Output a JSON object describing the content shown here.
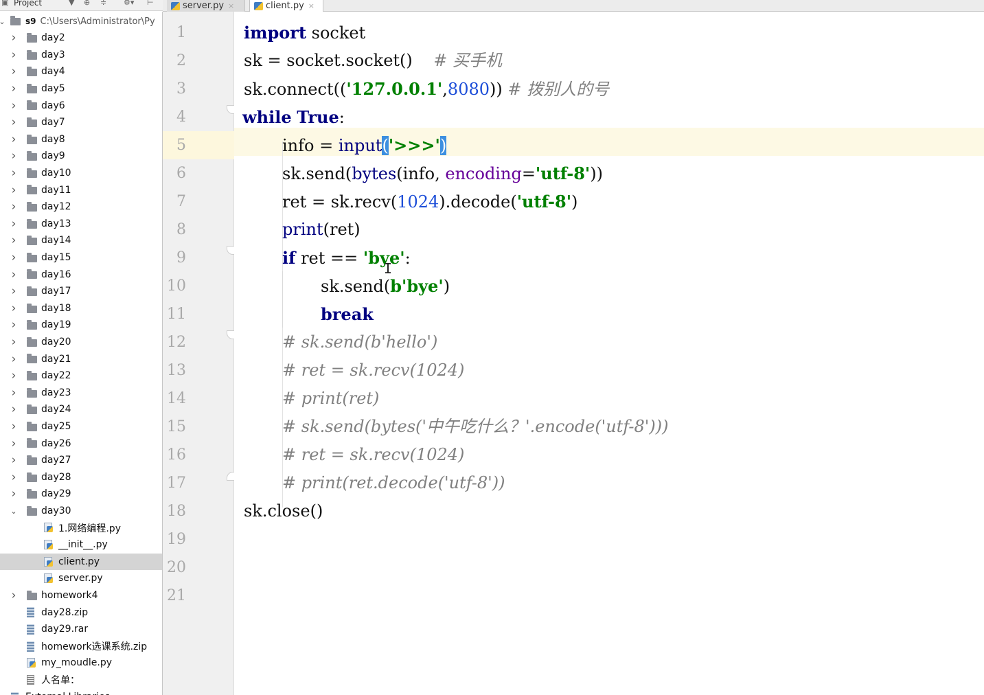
{
  "project_toolbar": {
    "title": "Project",
    "glyphs": [
      "▼",
      "⊕",
      "≑",
      "⚙▾",
      "⊢"
    ]
  },
  "tabs": [
    {
      "label": "server.py",
      "close": "×",
      "active": false
    },
    {
      "label": "client.py",
      "close": "×",
      "active": true
    }
  ],
  "tree": {
    "root": {
      "label": "s9",
      "path": "C:\\Users\\Administrator\\Py"
    },
    "days_collapsed": [
      "day2",
      "day3",
      "day4",
      "day5",
      "day6",
      "day7",
      "day8",
      "day9",
      "day10",
      "day11",
      "day12",
      "day13",
      "day14",
      "day15",
      "day16",
      "day17",
      "day18",
      "day19",
      "day20",
      "day21",
      "day22",
      "day23",
      "day24",
      "day25",
      "day26",
      "day27",
      "day28",
      "day29"
    ],
    "open_folder": "day30",
    "open_children": [
      "1.网络编程.py",
      "__init__.py",
      "client.py",
      "server.py"
    ],
    "selected_child": "client.py",
    "after": [
      {
        "label": "homework4",
        "kind": "folder"
      },
      {
        "label": "day28.zip",
        "kind": "zip"
      },
      {
        "label": "day29.rar",
        "kind": "zip"
      },
      {
        "label": "homework选课系统.zip",
        "kind": "zip"
      },
      {
        "label": "my_moudle.py",
        "kind": "py"
      },
      {
        "label": "人名单：",
        "kind": "txt"
      }
    ],
    "cut_off_label": "External Libraries"
  },
  "editor": {
    "line_numbers": [
      "1",
      "2",
      "3",
      "4",
      "5",
      "6",
      "7",
      "8",
      "9",
      "10",
      "11",
      "12",
      "13",
      "14",
      "15",
      "16",
      "17",
      "18",
      "19",
      "20",
      "21"
    ],
    "current_line": 5,
    "code": {
      "l1_kw": "import",
      "l1_rest": " socket",
      "l2_a": "sk = socket.socket()    ",
      "l2_cmt": "# 买手机",
      "l3_a": "sk.connect((",
      "l3_str": "'127.0.0.1'",
      "l3_b": ",",
      "l3_num": "8080",
      "l3_c": ")) ",
      "l3_cmt": "# 拨别人的号",
      "l4_kw1": "while",
      "l4_sp": " ",
      "l4_kw2": "True",
      "l4_colon": ":",
      "l5_a": "info = ",
      "l5_fn": "input",
      "l5_open": "(",
      "l5_str": "'>>>'",
      "l5_close": ")",
      "l6_a": "sk.send(",
      "l6_fn": "bytes",
      "l6_b": "(info, ",
      "l6_param": "encoding",
      "l6_eq": "=",
      "l6_str": "'utf-8'",
      "l6_c": "))",
      "l7_a": "ret = sk.recv(",
      "l7_num": "1024",
      "l7_b": ").decode(",
      "l7_str": "'utf-8'",
      "l7_c": ")",
      "l8_fn": "print",
      "l8_rest": "(ret)",
      "l9_kw": "if",
      "l9_a": " ret == ",
      "l9_str": "'bye'",
      "l9_b": ":",
      "l10_a": "sk.send(",
      "l10_str": "b'bye'",
      "l10_b": ")",
      "l11_kw": "break",
      "l12_cmt": "# sk.send(b'hello')",
      "l13_cmt": "# ret = sk.recv(1024)",
      "l14_cmt": "# print(ret)",
      "l15_cmt": "# sk.send(bytes('中午吃什么？'.encode('utf-8')))",
      "l16_cmt": "# ret = sk.recv(1024)",
      "l17_cmt": "# print(ret.decode('utf-8'))",
      "l18_a": "sk.close()"
    }
  },
  "colors": {
    "keyword": "#000080",
    "string": "#008000",
    "number": "#1d4ed8",
    "comment": "#808080",
    "parameter": "#660099",
    "current_line_bg": "#fdf9e4",
    "brace_match": "#3d8fe0",
    "selected_row": "#d4d4d4"
  }
}
